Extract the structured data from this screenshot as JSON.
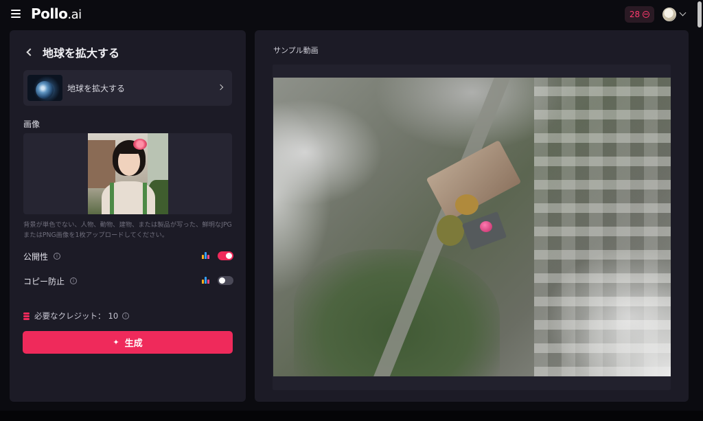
{
  "app": {
    "logo_main": "Pollo",
    "logo_suffix": ".ai"
  },
  "header": {
    "credits": "28"
  },
  "left": {
    "title": "地球を拡大する",
    "template": {
      "label": "地球を拡大する"
    },
    "image_section_label": "画像",
    "hint": "背景が単色でない、人物、動物、建物、または製品が写った、鮮明なJPGまたはPNG画像を1枚アップロードしてください。",
    "settings": [
      {
        "label": "公開性",
        "enabled": true
      },
      {
        "label": "コピー防止",
        "enabled": false
      }
    ],
    "credits_label": "必要なクレジット：",
    "credits_value": "10",
    "generate_label": "生成"
  },
  "right": {
    "title": "サンプル動画"
  },
  "colors": {
    "accent": "#ef2a5b",
    "panel": "#1c1b26",
    "background": "#0b0b10"
  }
}
